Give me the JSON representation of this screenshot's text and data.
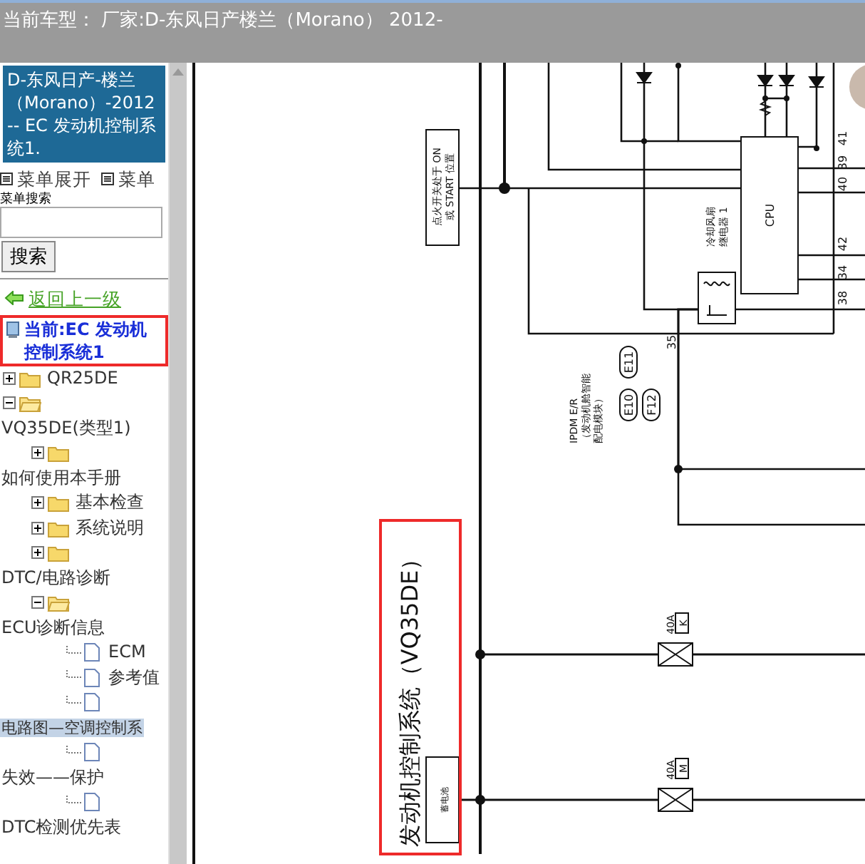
{
  "header": {
    "title": "当前车型：  厂家:D-东风日产楼兰（Morano） 2012-"
  },
  "sidebar": {
    "model_banner": "D-东风日产-楼兰（Morano）-2012-- EC 发动机控制系统1.",
    "menu_links": [
      "菜单展开",
      "菜单"
    ],
    "search": {
      "label": "菜单搜索",
      "button": "搜索"
    },
    "back_link": "返回上一级",
    "current": "当前:EC 发动机控制系统1",
    "tree": [
      {
        "label": "QR25DE",
        "kind": "folder",
        "expanded": false,
        "selected": false
      },
      {
        "label": "VQ35DE(类型1)",
        "kind": "folder",
        "expanded": true,
        "selected": false,
        "children": [
          {
            "label": "如何使用本手册",
            "kind": "folder",
            "expanded": false,
            "selected": false
          },
          {
            "label": "基本检查",
            "kind": "folder",
            "expanded": false,
            "selected": false
          },
          {
            "label": "系统说明",
            "kind": "folder",
            "expanded": false,
            "selected": false
          },
          {
            "label": "DTC/电路诊断",
            "kind": "folder",
            "expanded": false,
            "selected": false
          },
          {
            "label": "ECU诊断信息",
            "kind": "folder",
            "expanded": true,
            "selected": false,
            "children": [
              {
                "label": "ECM",
                "kind": "document",
                "selected": false
              },
              {
                "label": "参考值",
                "kind": "document",
                "selected": false
              },
              {
                "label": "电路图—空调控制系",
                "kind": "document",
                "selected": true
              },
              {
                "label": "失效——保护",
                "kind": "document",
                "selected": false
              },
              {
                "label": "DTC检测优先表",
                "kind": "document",
                "selected": false
              }
            ]
          }
        ]
      }
    ]
  },
  "diagram": {
    "title": "发动机控制系统（VQ35DE）",
    "ignition_label": [
      "点火开关处于 ON",
      "或 START 位置"
    ],
    "relay_label": [
      "冷却风扇",
      "继电器 1"
    ],
    "cpu": "CPU",
    "pins": [
      "41",
      "39",
      "40",
      "42",
      "34",
      "38",
      "35"
    ],
    "ipdm_label": [
      "IPDM E/R",
      "（发动机舱智能",
      "配电模块）"
    ],
    "connectors": [
      "E10",
      "E11",
      "F12"
    ],
    "battery": "蓄电池",
    "fuses": [
      {
        "rating": "40A",
        "code": "K"
      },
      {
        "rating": "40A",
        "code": "M"
      }
    ]
  }
}
